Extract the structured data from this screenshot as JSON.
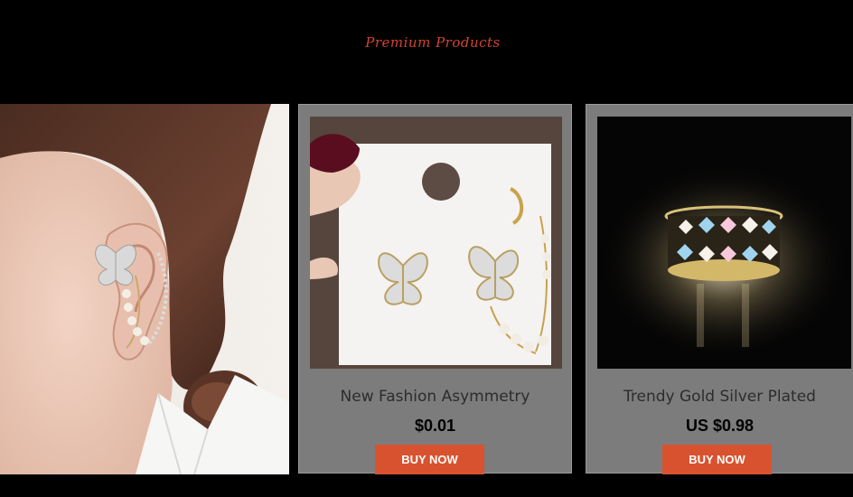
{
  "header": {
    "title": "Premium Products"
  },
  "hero": {
    "alt_icon": "model-ear-butterfly-earring-image"
  },
  "products": [
    {
      "name": "New Fashion Asymmetry",
      "price": "$0.01",
      "button": "BUY NOW",
      "image_icon": "butterfly-earring-card-image"
    },
    {
      "name": "Trendy Gold Silver Plated",
      "price": "US $0.98",
      "button": "BUY NOW",
      "image_icon": "butterfly-ring-image"
    }
  ]
}
